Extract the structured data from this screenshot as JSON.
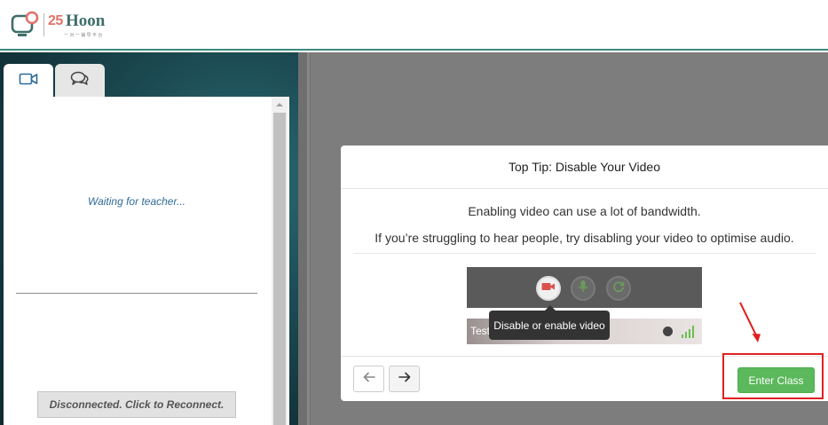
{
  "header": {
    "logo_icon": "monitor-camera-logo-icon",
    "logo_number": "25",
    "logo_word": "Hoon",
    "logo_tagline": "一对一辅导平台",
    "accent_color": "#3e8a80"
  },
  "sidebar": {
    "tabs": [
      {
        "icon": "video-camera-icon"
      },
      {
        "icon": "chat-bubbles-icon"
      }
    ],
    "waiting_text": "Waiting for teacher...",
    "reconnect_label": "Disconnected. Click to Reconnect."
  },
  "modal": {
    "title": "Top Tip: Disable Your Video",
    "line1": "Enabling video can use a lot of bandwidth.",
    "line2": "If you’re struggling to hear people, try disabling your video to optimise audio.",
    "preview": {
      "tooltip": "Disable or enable video",
      "strip_label": "Test",
      "controls": [
        "video-camera-icon",
        "microphone-icon",
        "refresh-icon"
      ]
    },
    "prev_icon": "arrow-left-icon",
    "next_icon": "arrow-right-icon",
    "enter_label": "Enter Class",
    "enter_color": "#5cb85c"
  },
  "annotation": {
    "color": "#e02020"
  }
}
